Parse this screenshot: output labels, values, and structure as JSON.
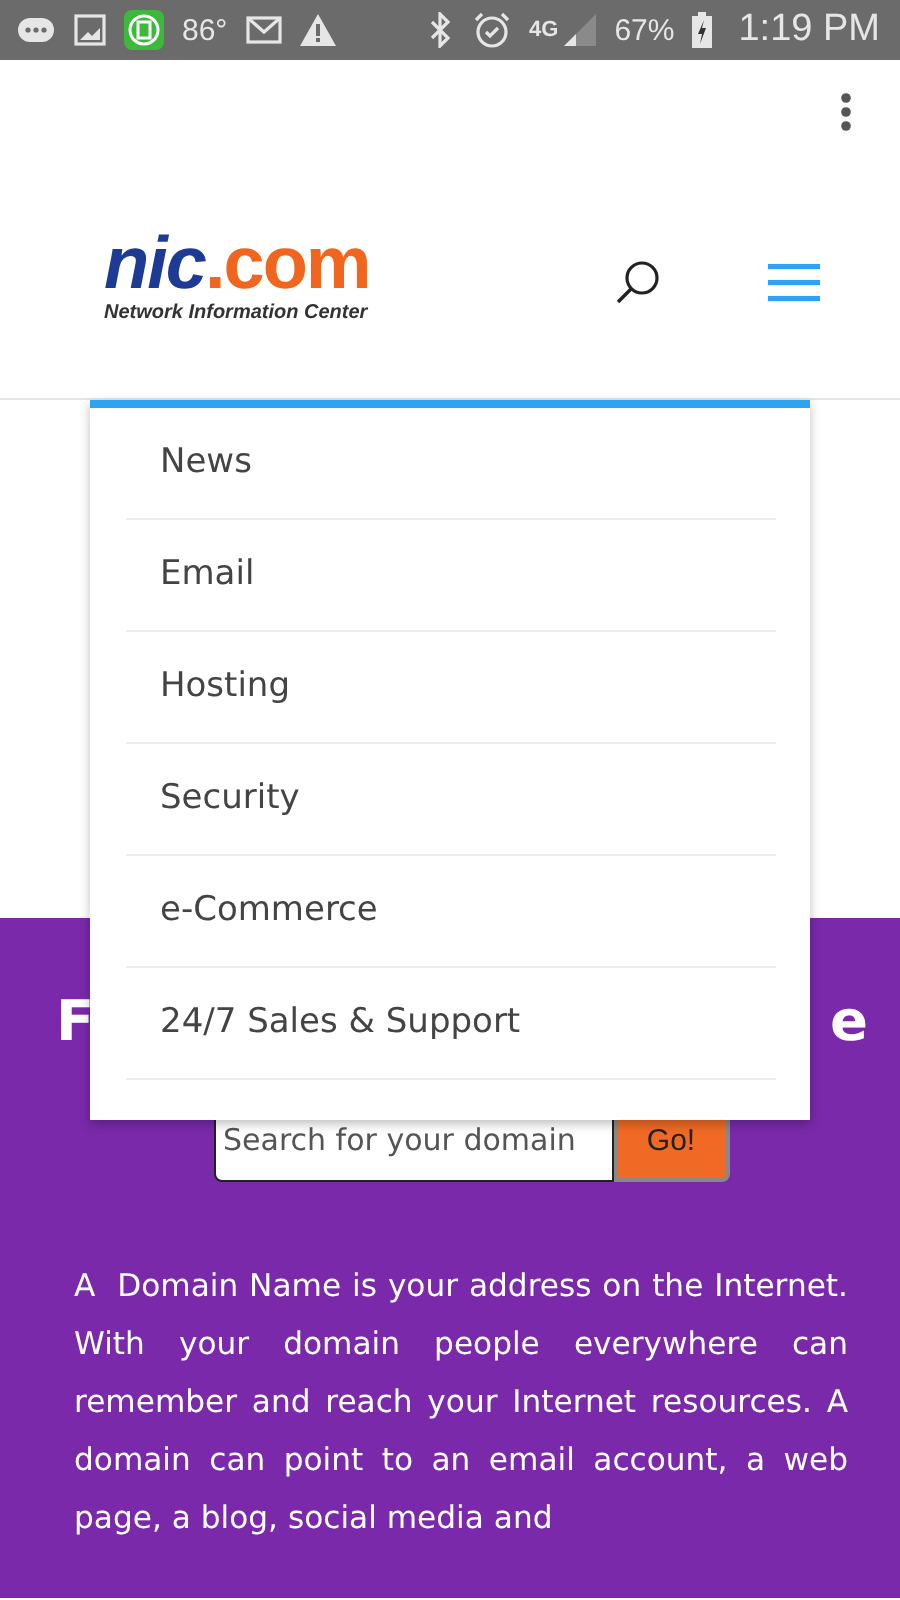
{
  "status_bar": {
    "temperature": "86°",
    "network": "4G",
    "battery": "67%",
    "time": "1:19 PM"
  },
  "header": {
    "logo": {
      "main": "nic",
      "accent": ".com",
      "tagline": "Network Information Center"
    }
  },
  "menu": {
    "items": [
      {
        "label": "News"
      },
      {
        "label": "Email"
      },
      {
        "label": "Hosting"
      },
      {
        "label": "Security"
      },
      {
        "label": "e-Commerce"
      },
      {
        "label": "24/7 Sales & Support"
      }
    ]
  },
  "hero": {
    "heading_start": "F",
    "heading_end": "e",
    "search": {
      "placeholder": "Search for your domain"
    },
    "button": "Go!",
    "paragraph": "A  Domain Name is your address on the Internet. With your domain people everywhere can remember and reach your Internet resources. A domain can point to an email account, a web page, a blog, social media and"
  }
}
